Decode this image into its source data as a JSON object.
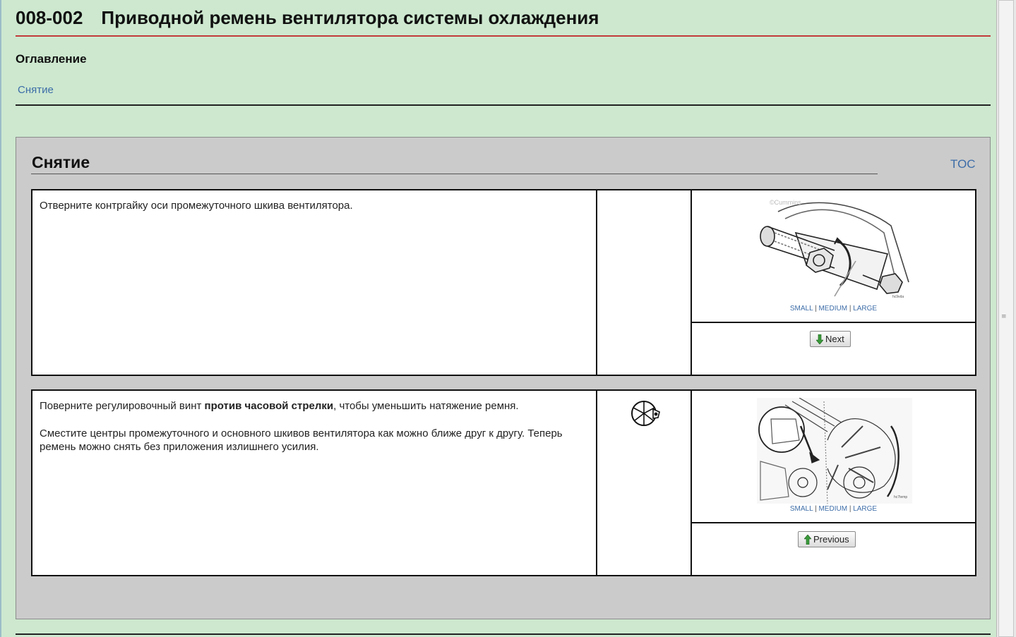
{
  "header": {
    "code": "008-002",
    "title": "Приводной ремень вентилятора системы охлаждения"
  },
  "toc": {
    "heading": "Оглавление",
    "items": [
      {
        "label": "Снятие"
      }
    ]
  },
  "section": {
    "title": "Снятие",
    "toc_link": "TOC",
    "steps": [
      {
        "text": "Отверните контргайку оси промежуточного шкива вентилятора.",
        "has_tool_icon": false,
        "image_caption": "hc9vda",
        "size_links": {
          "small": "SMALL",
          "medium": "MEDIUM",
          "large": "LARGE",
          "separator": "|"
        },
        "nav_button": "Next"
      },
      {
        "text_before_bold": "Поверните регулировочный винт ",
        "text_bold": "против часовой стрелки",
        "text_after_bold": ", чтобы уменьшить натяжение ремня.",
        "text_2": "Сместите центры промежуточного и основного шкивов вентилятора как можно ближе друг к другу. Теперь ремень можно снять без приложения излишнего усилия.",
        "has_tool_icon": true,
        "image_caption": "hc7temp",
        "size_links": {
          "small": "SMALL",
          "medium": "MEDIUM",
          "large": "LARGE",
          "separator": "|"
        },
        "nav_button": "Previous"
      }
    ]
  },
  "colors": {
    "page_bg": "#cde8cf",
    "section_bg": "#cbcbcb",
    "link": "#3d6da8",
    "title_rule": "#c23a3a"
  }
}
